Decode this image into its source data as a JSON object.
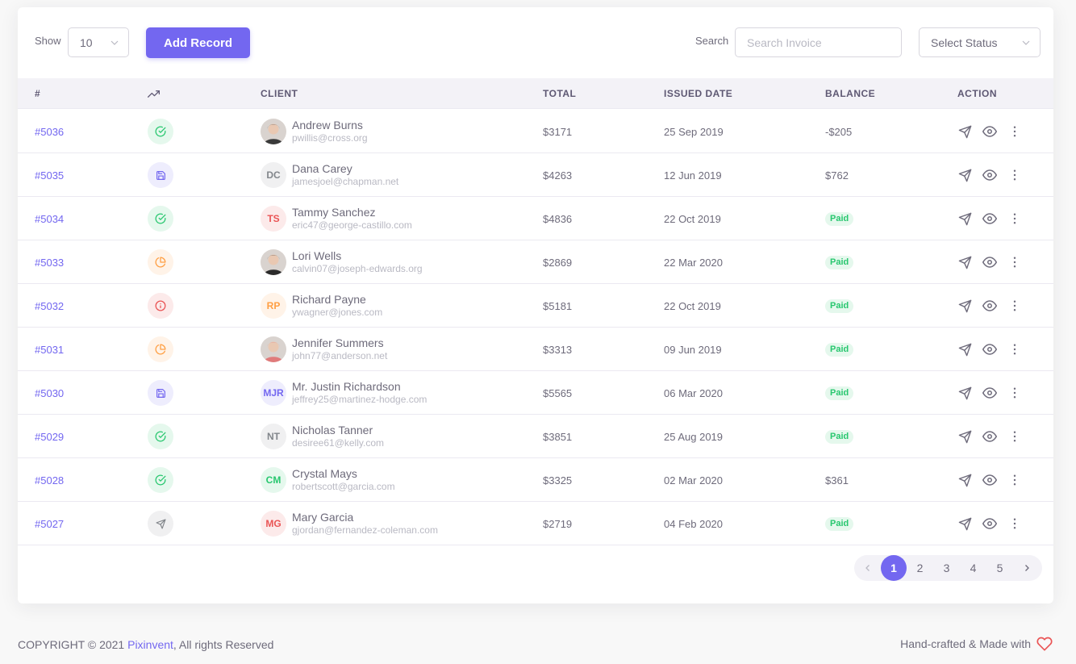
{
  "toolbar": {
    "show_label": "Show",
    "show_value": "10",
    "add_label": "Add Record",
    "search_label": "Search",
    "search_placeholder": "Search Invoice",
    "status_placeholder": "Select Status"
  },
  "columns": {
    "id": "#",
    "client": "Client",
    "total": "Total",
    "issued": "Issued Date",
    "balance": "Balance",
    "action": "Action"
  },
  "rows": [
    {
      "id": "#5036",
      "status_icon": "check-circle-icon",
      "status_color": "#28c76f",
      "status_bg": "#e5f8ed",
      "avatar_type": "photo",
      "avatar_color": "#3a3a3a",
      "initials": "",
      "name": "Andrew Burns",
      "email": "pwillis@cross.org",
      "total": "$3171",
      "date": "25 Sep 2019",
      "balance": "-$205",
      "paid": false
    },
    {
      "id": "#5035",
      "status_icon": "save-icon",
      "status_color": "#7367f0",
      "status_bg": "#eeedfd",
      "avatar_type": "initials",
      "avatar_color": "#82868b",
      "avatar_bg": "#f0f0f1",
      "initials": "DC",
      "name": "Dana Carey",
      "email": "jamesjoel@chapman.net",
      "total": "$4263",
      "date": "12 Jun 2019",
      "balance": "$762",
      "paid": false
    },
    {
      "id": "#5034",
      "status_icon": "check-circle-icon",
      "status_color": "#28c76f",
      "status_bg": "#e5f8ed",
      "avatar_type": "initials",
      "avatar_color": "#ea5455",
      "avatar_bg": "#fceaea",
      "initials": "TS",
      "name": "Tammy Sanchez",
      "email": "eric47@george-castillo.com",
      "total": "$4836",
      "date": "22 Oct 2019",
      "balance": "Paid",
      "paid": true
    },
    {
      "id": "#5033",
      "status_icon": "pie-chart-icon",
      "status_color": "#ff9f43",
      "status_bg": "#fff3e8",
      "avatar_type": "photo",
      "avatar_color": "#2b2b2b",
      "initials": "",
      "name": "Lori Wells",
      "email": "calvin07@joseph-edwards.org",
      "total": "$2869",
      "date": "22 Mar 2020",
      "balance": "Paid",
      "paid": true
    },
    {
      "id": "#5032",
      "status_icon": "info-icon",
      "status_color": "#ea5455",
      "status_bg": "#fceaea",
      "avatar_type": "initials",
      "avatar_color": "#ff9f43",
      "avatar_bg": "#fff3e8",
      "initials": "RP",
      "name": "Richard Payne",
      "email": "ywagner@jones.com",
      "total": "$5181",
      "date": "22 Oct 2019",
      "balance": "Paid",
      "paid": true
    },
    {
      "id": "#5031",
      "status_icon": "pie-chart-icon",
      "status_color": "#ff9f43",
      "status_bg": "#fff3e8",
      "avatar_type": "photo",
      "avatar_color": "#e07b7b",
      "initials": "",
      "name": "Jennifer Summers",
      "email": "john77@anderson.net",
      "total": "$3313",
      "date": "09 Jun 2019",
      "balance": "Paid",
      "paid": true
    },
    {
      "id": "#5030",
      "status_icon": "save-icon",
      "status_color": "#7367f0",
      "status_bg": "#eeedfd",
      "avatar_type": "initials",
      "avatar_color": "#7367f0",
      "avatar_bg": "#eeedfd",
      "initials": "MJR",
      "name": "Mr. Justin Richardson",
      "email": "jeffrey25@martinez-hodge.com",
      "total": "$5565",
      "date": "06 Mar 2020",
      "balance": "Paid",
      "paid": true
    },
    {
      "id": "#5029",
      "status_icon": "check-circle-icon",
      "status_color": "#28c76f",
      "status_bg": "#e5f8ed",
      "avatar_type": "initials",
      "avatar_color": "#82868b",
      "avatar_bg": "#f0f0f1",
      "initials": "NT",
      "name": "Nicholas Tanner",
      "email": "desiree61@kelly.com",
      "total": "$3851",
      "date": "25 Aug 2019",
      "balance": "Paid",
      "paid": true
    },
    {
      "id": "#5028",
      "status_icon": "check-circle-icon",
      "status_color": "#28c76f",
      "status_bg": "#e5f8ed",
      "avatar_type": "initials",
      "avatar_color": "#28c76f",
      "avatar_bg": "#e5f8ed",
      "initials": "CM",
      "name": "Crystal Mays",
      "email": "robertscott@garcia.com",
      "total": "$3325",
      "date": "02 Mar 2020",
      "balance": "$361",
      "paid": false
    },
    {
      "id": "#5027",
      "status_icon": "send-icon",
      "status_color": "#82868b",
      "status_bg": "#f0f0f1",
      "avatar_type": "initials",
      "avatar_color": "#ea5455",
      "avatar_bg": "#fceaea",
      "initials": "MG",
      "name": "Mary Garcia",
      "email": "gjordan@fernandez-coleman.com",
      "total": "$2719",
      "date": "04 Feb 2020",
      "balance": "Paid",
      "paid": true
    }
  ],
  "pagination": {
    "pages": [
      "1",
      "2",
      "3",
      "4",
      "5"
    ],
    "active": "1"
  },
  "footer": {
    "copyright": "COPYRIGHT © 2021 ",
    "brand": "Pixinvent",
    "rights": ", All rights Reserved",
    "made_with": "Hand-crafted & Made with"
  },
  "colors": {
    "primary": "#7367f0",
    "success": "#28c76f",
    "heart": "#ea5455"
  }
}
